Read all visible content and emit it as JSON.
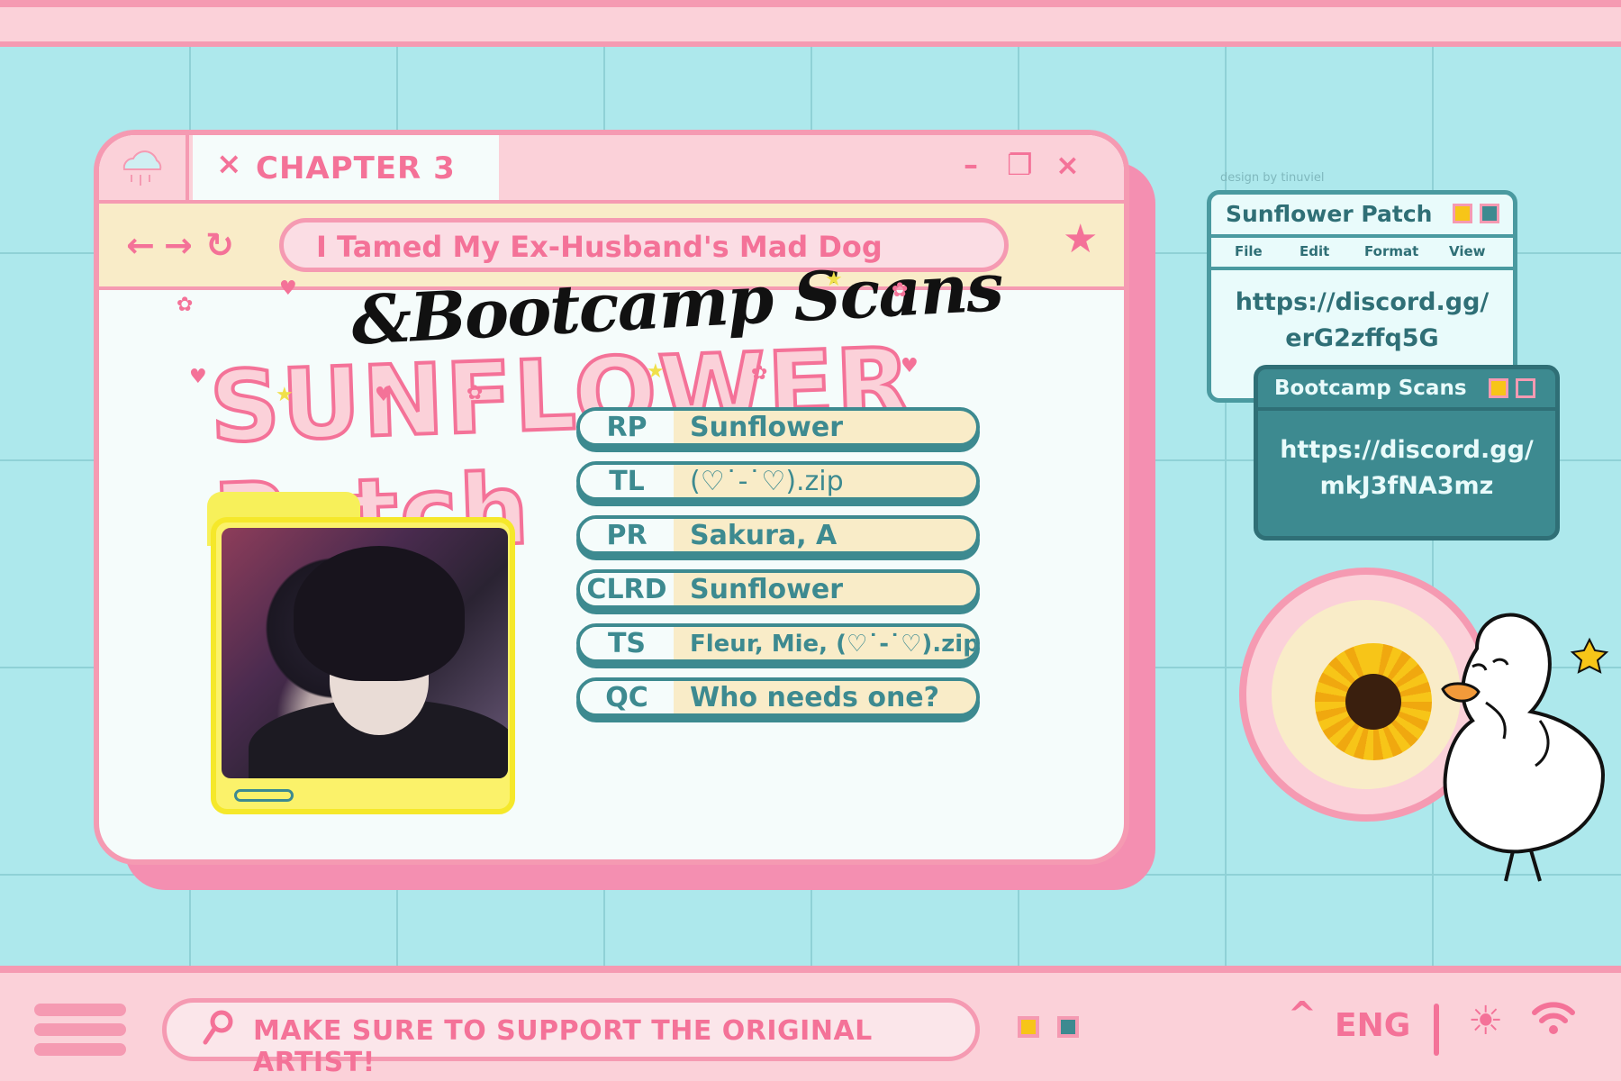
{
  "tab": {
    "close_glyph": "×",
    "label": "CHAPTER 3"
  },
  "window_controls": {
    "minimize": "–",
    "restore": "❐",
    "close": "×"
  },
  "nav": {
    "back": "←",
    "forward": "→",
    "refresh": "↻",
    "bookmark": "★"
  },
  "address": {
    "value": "I Tamed My Ex-Husband's Mad Dog"
  },
  "header": {
    "collab": "&Bootcamp Scans",
    "group": "SUNFLOWER Patch"
  },
  "credits": [
    {
      "role": "RP",
      "name": "Sunflower"
    },
    {
      "role": "TL",
      "name": "(♡˙-˙♡).zip"
    },
    {
      "role": "PR",
      "name": "Sakura, A"
    },
    {
      "role": "CLRD",
      "name": "Sunflower"
    },
    {
      "role": "TS",
      "name": "Fleur, Mie, (♡˙-˙♡).zip"
    },
    {
      "role": "QC",
      "name": "Who needs one?"
    }
  ],
  "credit_line": "design by tinuviel",
  "sunflower_window": {
    "title": "Sunflower Patch",
    "menu": [
      "File",
      "Edit",
      "Format",
      "View"
    ],
    "link_line1": "https://discord.gg/",
    "link_line2": "erG2zffq5G"
  },
  "bootcamp_window": {
    "title": "Bootcamp Scans",
    "link_line1": "https://discord.gg/",
    "link_line2": "mkJ3fNA3mz"
  },
  "taskbar": {
    "search_text": "MAKE SURE TO SUPPORT THE ORIGINAL ARTIST!",
    "caret": "^",
    "language": "ENG",
    "sun_glyph": "☀"
  },
  "colors": {
    "pink": "#f59ab2",
    "pink_text": "#f47298",
    "teal": "#3d8a90",
    "sky": "#ade8ec",
    "cream": "#f9ecc8"
  }
}
